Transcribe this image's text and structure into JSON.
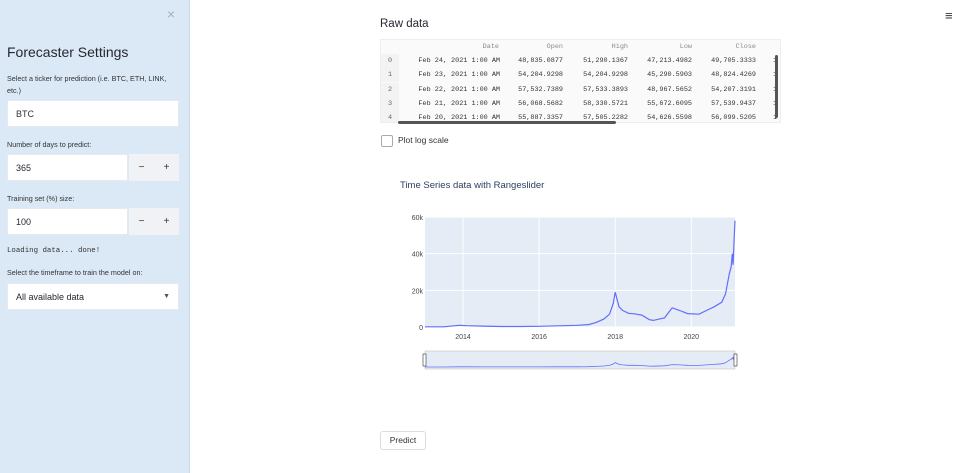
{
  "sidebar": {
    "close_glyph": "×",
    "title": "Forecaster Settings",
    "ticker_label": "Select a ticker for prediction (i.e. BTC, ETH, LINK, etc.)",
    "ticker_value": "BTC",
    "days_label": "Number of days to predict:",
    "days_value": "365",
    "train_label": "Training set (%) size:",
    "train_value": "100",
    "minus": "−",
    "plus": "+",
    "loading_text": "Loading data... done!",
    "timeframe_label": "Select the timeframe to train the model on:",
    "timeframe_value": "All available data"
  },
  "main": {
    "menu_glyph": "≡",
    "raw_title": "Raw data",
    "table": {
      "columns": [
        "Date",
        "Open",
        "High",
        "Low",
        "Close"
      ],
      "rows": [
        {
          "idx": "0",
          "cells": [
            "Feb 24, 2021 1:00 AM",
            "48,835.0877",
            "51,290.1367",
            "47,213.4982",
            "49,705.3333"
          ]
        },
        {
          "idx": "1",
          "cells": [
            "Feb 23, 2021 1:00 AM",
            "54,204.9298",
            "54,204.9298",
            "45,290.5903",
            "48,824.4269"
          ]
        },
        {
          "idx": "2",
          "cells": [
            "Feb 22, 2021 1:00 AM",
            "57,532.7389",
            "57,533.3893",
            "48,967.5652",
            "54,207.3191"
          ]
        },
        {
          "idx": "3",
          "cells": [
            "Feb 21, 2021 1:00 AM",
            "56,068.5682",
            "58,330.5721",
            "55,672.6095",
            "57,539.9437"
          ]
        },
        {
          "idx": "4",
          "cells": [
            "Feb 20, 2021 1:00 AM",
            "55,887.3357",
            "57,505.2282",
            "54,626.5598",
            "56,099.5205"
          ]
        }
      ],
      "overflow_glyph": "1"
    },
    "log_scale_label": "Plot log scale",
    "predict_label": "Predict"
  },
  "chart_data": {
    "type": "line",
    "title": "Time Series data with Rangeslider",
    "xlabel": "",
    "ylabel": "",
    "x_ticks": [
      "2014",
      "2016",
      "2018",
      "2020"
    ],
    "y_ticks": [
      "0",
      "20k",
      "40k",
      "60k"
    ],
    "ylim": [
      0,
      60000
    ],
    "xlim": [
      2013.0,
      2021.15
    ],
    "line_color": "#636efa",
    "series": [
      {
        "x": [
          2013.0,
          2013.5,
          2013.9,
          2014.1,
          2014.5,
          2015.0,
          2015.5,
          2016.0,
          2016.5,
          2017.0,
          2017.3,
          2017.5,
          2017.7,
          2017.85,
          2017.95,
          2018.0,
          2018.1,
          2018.2,
          2018.35,
          2018.5,
          2018.7,
          2018.9,
          2019.0,
          2019.3,
          2019.5,
          2019.7,
          2019.9,
          2020.2,
          2020.4,
          2020.6,
          2020.8,
          2020.9,
          2021.0,
          2021.05,
          2021.08,
          2021.1,
          2021.13,
          2021.15
        ],
        "y": [
          100,
          120,
          900,
          700,
          500,
          300,
          250,
          400,
          650,
          900,
          1300,
          2500,
          4300,
          7000,
          13000,
          19000,
          11000,
          9000,
          7500,
          7200,
          6500,
          4000,
          3600,
          5000,
          10500,
          9000,
          7300,
          7000,
          9000,
          11000,
          13500,
          18000,
          29000,
          33000,
          40000,
          34000,
          49000,
          58000
        ]
      }
    ],
    "grid": true,
    "rangeslider": true
  }
}
